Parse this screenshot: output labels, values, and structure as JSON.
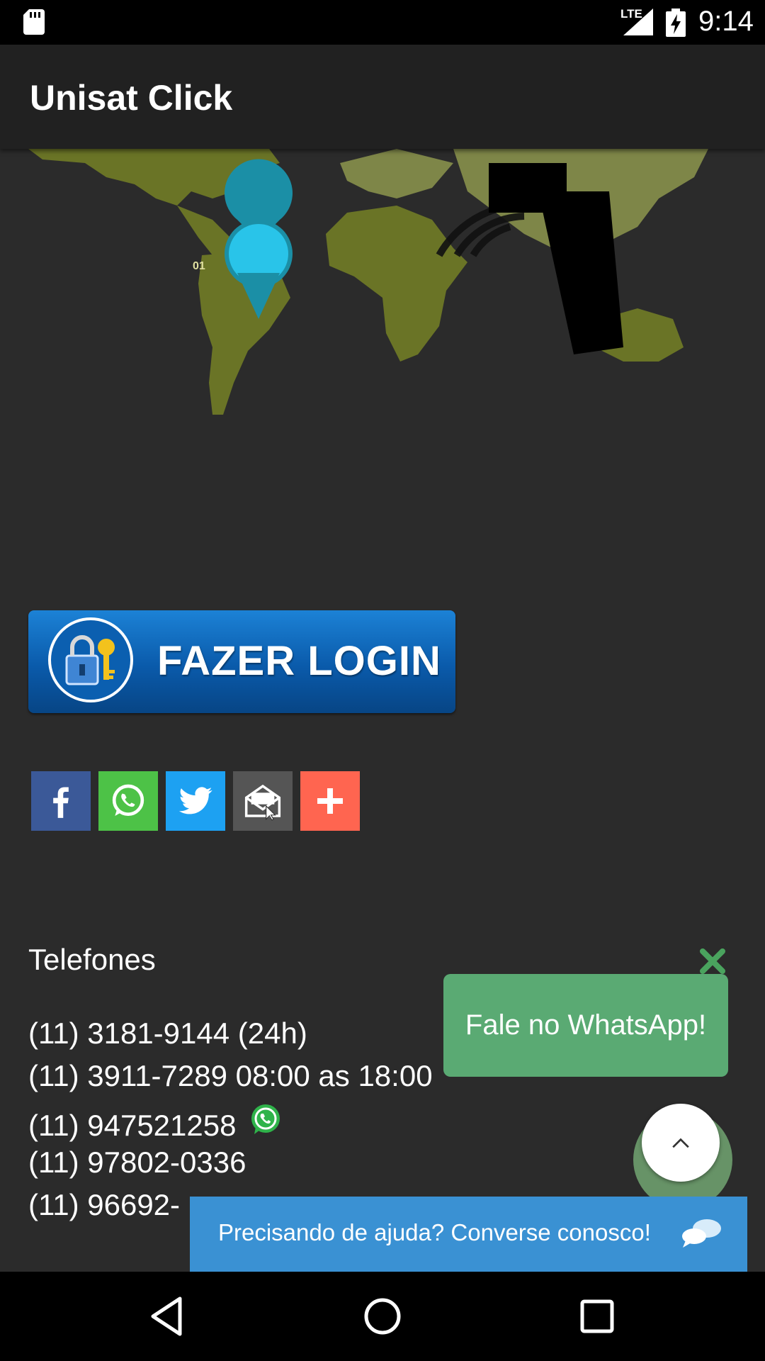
{
  "status_bar": {
    "network": "LTE",
    "time": "9:14"
  },
  "app_bar": {
    "title": "Unisat Click"
  },
  "banner": {
    "marker_label": "01",
    "colors": {
      "land": "#6a7426",
      "land_light": "#7e8648",
      "marker": "#29c4e9"
    }
  },
  "login": {
    "label": "FAZER LOGIN"
  },
  "share_buttons": [
    {
      "name": "facebook",
      "color": "#3b5998",
      "icon": "facebook-icon"
    },
    {
      "name": "whatsapp",
      "color": "#4dc247",
      "icon": "whatsapp-icon"
    },
    {
      "name": "twitter",
      "color": "#1da1f2",
      "icon": "twitter-icon"
    },
    {
      "name": "email",
      "color": "#555555",
      "icon": "email-icon"
    },
    {
      "name": "more",
      "color": "#ff6550",
      "icon": "plus-icon"
    }
  ],
  "phones": {
    "title": "Telefones",
    "lines": [
      "(11) 3181-9144 (24h)",
      "(11) 3911-7289 08:00 as 18:00",
      "(11) 947521258",
      "(11) 97802-0336",
      "(11) 96692-"
    ]
  },
  "whatsapp_popup": {
    "label": "Fale no WhatsApp!",
    "color": "#5aaa73"
  },
  "chat_bar": {
    "label": "Precisando de ajuda? Converse conosco!",
    "color": "#3a91d3"
  }
}
